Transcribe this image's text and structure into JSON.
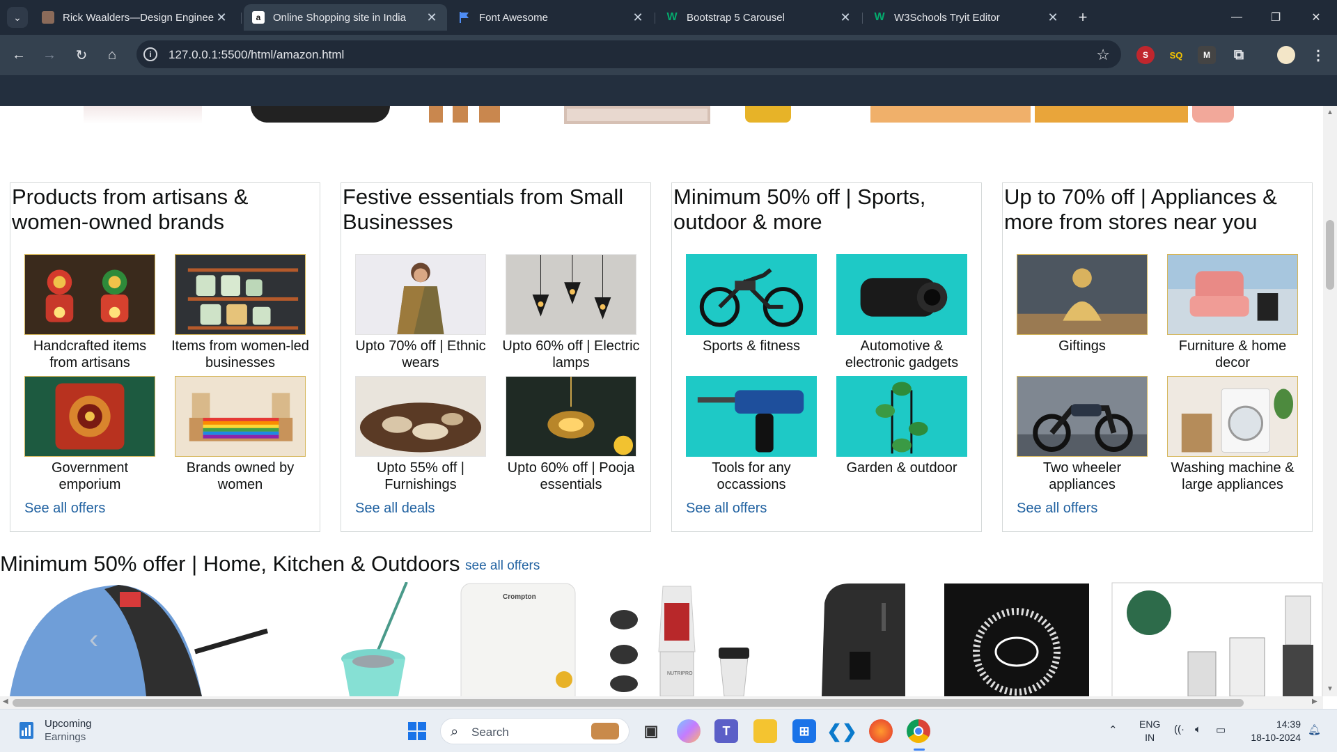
{
  "browser": {
    "tabs": [
      {
        "title": "Rick Waalders—Design Enginee",
        "favicon": "person-photo-icon",
        "active": false
      },
      {
        "title": "Online Shopping site in India",
        "favicon": "amazon-icon",
        "active": true
      },
      {
        "title": "Font Awesome",
        "favicon": "font-awesome-flag-icon",
        "active": false
      },
      {
        "title": "Bootstrap 5 Carousel",
        "favicon": "w3schools-icon",
        "active": false
      },
      {
        "title": "W3Schools Tryit Editor",
        "favicon": "w3schools-icon",
        "active": false
      }
    ],
    "url": "127.0.0.1:5500/html/amazon.html"
  },
  "cards": [
    {
      "title": "Products from artisans & women-owned brands",
      "tiles": [
        {
          "label": "Handcrafted items from artisans",
          "image": "handcrafted-dolls-image"
        },
        {
          "label": "Items from women-led businesses",
          "image": "storage-jars-shelf-image"
        },
        {
          "label": "Government emporium",
          "image": "embroidered-cushion-image"
        },
        {
          "label": "Brands owned by women",
          "image": "rainbow-table-runner-image"
        }
      ],
      "link": "See all offers"
    },
    {
      "title": "Festive essentials from Small Businesses",
      "tiles": [
        {
          "label": "Upto 70% off | Ethnic wears",
          "image": "saree-model-image"
        },
        {
          "label": "Upto 60% off | Electric lamps",
          "image": "pendant-lamps-image"
        },
        {
          "label": "Upto 55% off | Furnishings",
          "image": "shaggy-rug-image"
        },
        {
          "label": "Upto 60% off | Pooja essentials",
          "image": "brass-lantern-image"
        }
      ],
      "link": "See all deals"
    },
    {
      "title": "Minimum 50% off | Sports, outdoor & more",
      "tiles": [
        {
          "label": "Sports & fitness",
          "image": "electric-bicycle-image"
        },
        {
          "label": "Automotive & electronic gadgets",
          "image": "dash-camera-image"
        },
        {
          "label": "Tools for any occassions",
          "image": "rotary-hammer-drill-image"
        },
        {
          "label": "Garden & outdoor",
          "image": "plant-stand-image"
        }
      ],
      "link": "See all offers"
    },
    {
      "title": "Up to 70% off | Appliances & more from stores near you",
      "tiles": [
        {
          "label": "Giftings",
          "image": "buddha-statue-image"
        },
        {
          "label": "Furniture & home decor",
          "image": "pink-armchair-image"
        },
        {
          "label": "Two wheeler appliances",
          "image": "motorcycle-image"
        },
        {
          "label": "Washing machine & large appliances",
          "image": "washing-machine-image"
        }
      ],
      "link": "See all offers"
    }
  ],
  "section": {
    "title": "Minimum 50% offer | Home, Kitchen & Outdoors",
    "link": "see all offers",
    "carousel_items": [
      {
        "image": "blue-sandwich-maker-image"
      },
      {
        "image": "spin-mop-bucket-image"
      },
      {
        "image": "crompton-water-heater-image",
        "brand_text": "Crompton"
      },
      {
        "image": "nutripro-blender-image",
        "brand_text": "NUTRIPRO"
      },
      {
        "image": "black-water-purifier-image"
      },
      {
        "image": "induction-cooktop-image"
      },
      {
        "image": "mixer-grinder-set-image"
      }
    ]
  },
  "taskbar": {
    "weather_title": "Upcoming",
    "weather_sub": "Earnings",
    "search_placeholder": "Search",
    "lang_line1": "ENG",
    "lang_line2": "IN",
    "time": "14:39",
    "date": "18-10-2024"
  },
  "colors": {
    "chrome_dark": "#202a38",
    "chrome_toolbar": "#34414f",
    "amazon_nav": "#232f3e",
    "link": "#2162a1",
    "tile_border": "#d5b65a",
    "teal_bg": "#1ec9c6"
  }
}
